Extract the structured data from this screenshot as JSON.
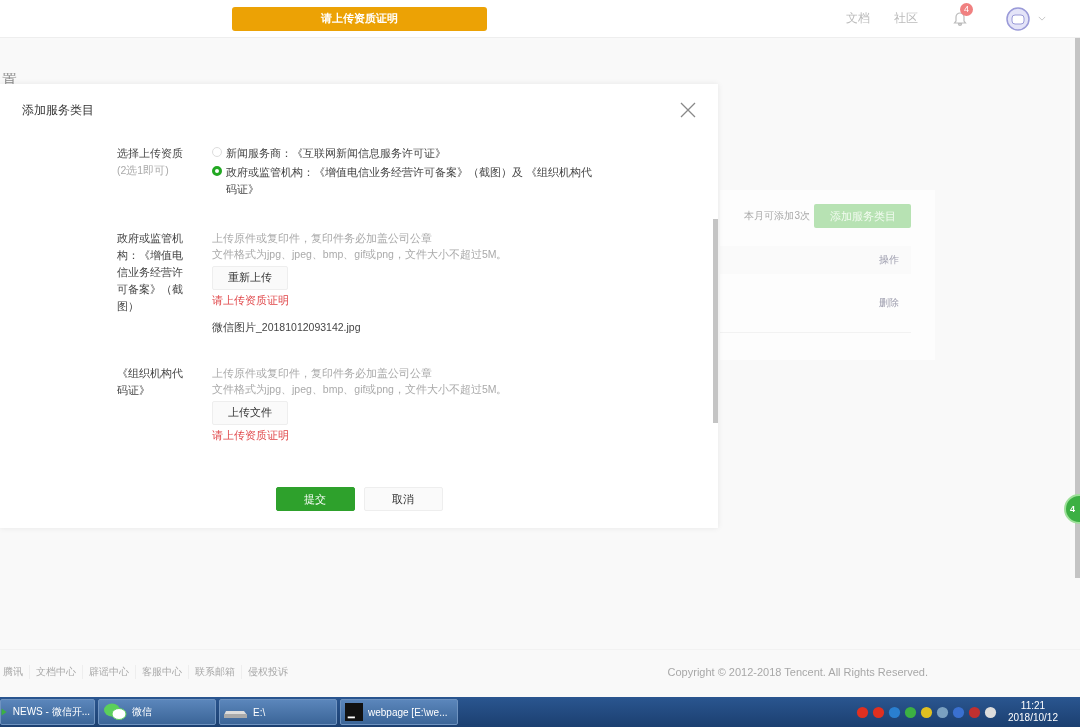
{
  "header": {
    "notice_button": "请上传资质证明",
    "links": [
      "文档",
      "社区"
    ],
    "notification_count": "4"
  },
  "page": {
    "title": "置",
    "card": {
      "quota": "本月可添加3次",
      "add_button": "添加服务类目",
      "column_header": "操作",
      "row_action": "删除"
    }
  },
  "dialog": {
    "title": "添加服务类目",
    "fields": [
      {
        "kind": "radio",
        "label": "选择上传资质",
        "hint": "(2选1即可)",
        "options": [
          {
            "text": "新闻服务商：《互联网新闻信息服务许可证》",
            "selected": false
          },
          {
            "text": "政府或监管机构：《增值电信业务经营许可备案》（截图）及 《组织机构代码证》",
            "selected": true
          }
        ]
      },
      {
        "kind": "upload",
        "label": "政府或监管机构：《增值电信业务经营许可备案》（截图）",
        "notes": [
          "上传原件或复印件，复印件务必加盖公司公章",
          "文件格式为jpg、jpeg、bmp、gif或png，文件大小不超过5M。"
        ],
        "button": "重新上传",
        "error": "请上传资质证明",
        "file": "微信图片_20181012093142.jpg"
      },
      {
        "kind": "upload",
        "label": "《组织机构代码证》",
        "notes": [
          "上传原件或复印件，复印件务必加盖公司公章",
          "文件格式为jpg、jpeg、bmp、gif或png，文件大小不超过5M。"
        ],
        "button": "上传文件",
        "error": "请上传资质证明"
      }
    ],
    "buttons": [
      {
        "kind": "primary",
        "label": "提交"
      },
      {
        "kind": "default",
        "label": "取消"
      }
    ]
  },
  "footer": {
    "links": [
      "腾讯",
      "文档中心",
      "辟谣中心",
      "客服中心",
      "联系邮箱",
      "侵权投诉"
    ],
    "copyright": "Copyright © 2012-2018 Tencent. All Rights Reserved."
  },
  "floating_badge": "4",
  "taskbar": {
    "items": [
      {
        "kind": "news",
        "label": "NEWS - 微信开..."
      },
      {
        "kind": "wechat",
        "label": "微信"
      },
      {
        "kind": "drive",
        "label": "E:\\"
      },
      {
        "kind": "ws",
        "label": "webpage [E:\\we..."
      }
    ],
    "time": "11:21",
    "date": "2018/10/12"
  }
}
